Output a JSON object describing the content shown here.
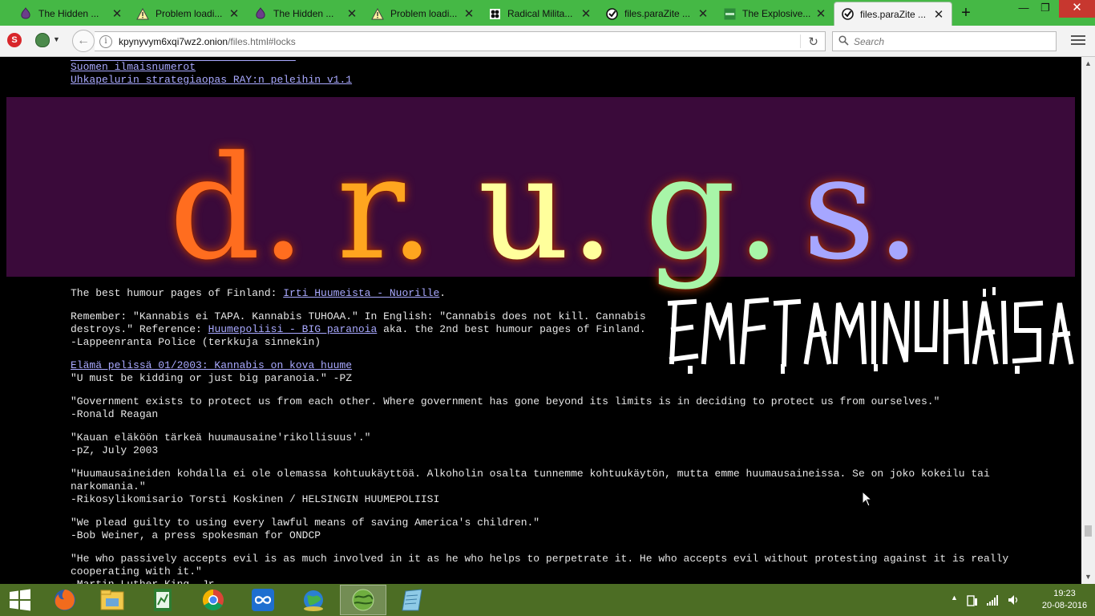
{
  "browser": {
    "tabs": [
      {
        "label": "The Hidden ...",
        "icon": "onion-icon"
      },
      {
        "label": "Problem loadi...",
        "icon": "warning-icon"
      },
      {
        "label": "The Hidden ...",
        "icon": "onion-icon"
      },
      {
        "label": "Problem loadi...",
        "icon": "warning-icon"
      },
      {
        "label": "Radical Milita...",
        "icon": "site-favicon-icon"
      },
      {
        "label": "files.paraZite ...",
        "icon": "parazite-favicon-icon"
      },
      {
        "label": "The Explosive...",
        "icon": "book-favicon-icon"
      },
      {
        "label": "files.paraZite ...",
        "icon": "parazite-favicon-icon",
        "active": true
      }
    ],
    "new_tab_label": "+",
    "window_controls": {
      "minimize": "—",
      "restore": "❐",
      "close": "✕"
    },
    "url_host": "kpynyvym6xqi7wz2.onion",
    "url_path": "/files.html#locks",
    "search_placeholder": "Search"
  },
  "page": {
    "top_links": [
      "Suomen ilmaisnumerot",
      "Uhkapelurin strategiaopas RAY:n peleihin v1.1"
    ],
    "banner_letters": [
      "d.",
      "r.",
      "u.",
      "g.",
      "s."
    ],
    "banner_colors": [
      "#ff6d1f",
      "#ffa51f",
      "#ffff9c",
      "#a8f5a8",
      "#a6a6ff"
    ],
    "humour_prefix": "The best humour pages of Finland: ",
    "humour_link": "Irti Huumeista - Nuorille",
    "humour_suffix": ".",
    "remember_1": "Remember: \"Kannabis ei TAPA. Kannabis TUHOAA.\" In English: \"Cannabis does not kill. Cannabis",
    "remember_2a": "destroys.\" Reference: ",
    "remember_link": "Huumepoliisi - BIG paranoia",
    "remember_2b": " aka. the 2nd best humour pages of Finland.",
    "remember_3": "-Lappeenranta Police (terkkuja sinnekin)",
    "elama_link": "Elämä pelissä 01/2003: Kannabis on kova huume",
    "elama_quote": "\"U must be kidding or just big paranoia.\" -PZ",
    "quote_reagan": "\"Government exists to protect us from each other. Where government has gone beyond its limits is in deciding to protect us from ourselves.\"",
    "author_reagan": "-Ronald Reagan",
    "quote_kauan": "\"Kauan eläköön tärkeä huumausaine'rikollisuus'.\"",
    "author_kauan": "-pZ, July 2003",
    "quote_koskinen_1": "\"Huumausaineiden kohdalla ei ole olemassa kohtuukäyttöä. Alkoholin osalta tunnemme kohtuukäytön, mutta emme huumausaineissa. Se on joko kokeilu tai",
    "quote_koskinen_2": "narkomania.\"",
    "author_koskinen": "-Rikosylikomisario Torsti Koskinen / HELSINGIN HUUMEPOLIISI",
    "quote_weiner": "\"We plead guilty to using every lawful means of saving America's children.\"",
    "author_weiner": "-Bob Weiner, a press spokesman for ONDCP",
    "quote_king_1": "\"He who passively accepts evil is as much involved in it as he who helps to perpetrate it. He who accepts evil without protesting against it is really",
    "quote_king_2": "cooperating with it.\""
  },
  "taskbar": {
    "items": [
      "firefox-icon",
      "file-explorer-icon",
      "spreadsheet-app-icon",
      "chrome-icon",
      "infinity-app-icon",
      "globe-app-icon",
      "tor-browser-icon",
      "notepad-app-icon"
    ],
    "active_index": 6,
    "clock_time": "19:23",
    "clock_date": "20-08-2016"
  }
}
